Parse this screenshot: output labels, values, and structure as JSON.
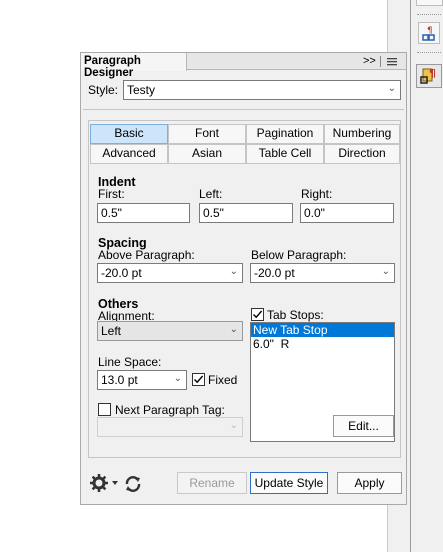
{
  "panel": {
    "title": "Paragraph Designer",
    "expand_label": ">>",
    "style_label": "Style:",
    "style_value": "Testy"
  },
  "tabs": [
    "Basic",
    "Font",
    "Pagination",
    "Numbering",
    "Advanced",
    "Asian",
    "Table Cell",
    "Direction"
  ],
  "indent": {
    "header": "Indent",
    "first_label": "First:",
    "first_value": "0.5\"",
    "left_label": "Left:",
    "left_value": "0.5\"",
    "right_label": "Right:",
    "right_value": "0.0\""
  },
  "spacing": {
    "header": "Spacing",
    "above_label": "Above Paragraph:",
    "above_value": "-20.0 pt",
    "below_label": "Below Paragraph:",
    "below_value": "-20.0 pt"
  },
  "others": {
    "header": "Others",
    "alignment_label": "Alignment:",
    "alignment_value": "Left",
    "line_space_label": "Line Space:",
    "line_space_value": "13.0 pt",
    "fixed_label": "Fixed",
    "next_tag_label": "Next Paragraph Tag:",
    "next_tag_value": ""
  },
  "tab_stops": {
    "label": "Tab Stops:",
    "items": [
      "New Tab Stop",
      "6.0\"  R"
    ],
    "edit_label": "Edit..."
  },
  "footer": {
    "rename_label": "Rename",
    "update_label": "Update Style",
    "apply_label": "Apply"
  },
  "colors": {
    "selection": "#0078d7",
    "selected_tab": "#cde5fa",
    "panel_bg": "#f0f0f0"
  }
}
